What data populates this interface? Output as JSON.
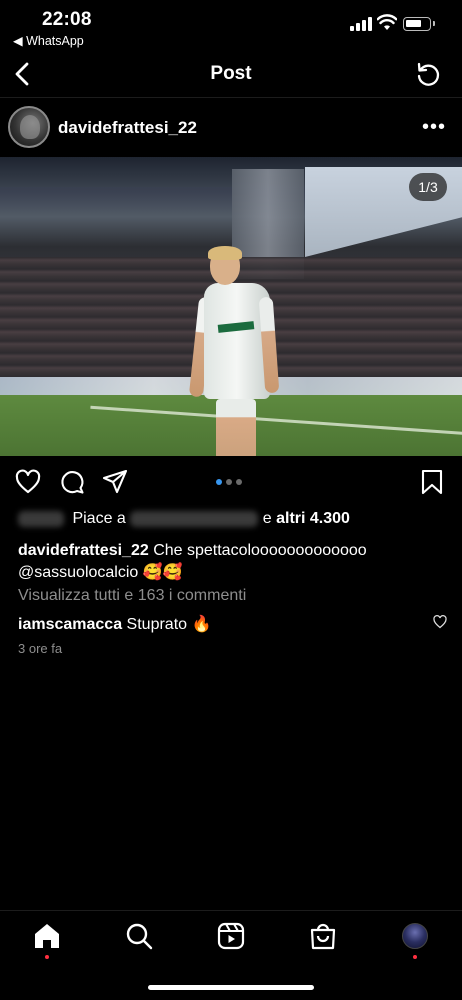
{
  "status_bar": {
    "time": "22:08",
    "back_app": "◀ WhatsApp"
  },
  "nav": {
    "title": "Post"
  },
  "post": {
    "username": "davidefrattesi_22",
    "photo_page": "1/3",
    "carousel": {
      "total": 3,
      "active": 1
    },
    "likes": {
      "prefix": "Piace a",
      "suffix": "e",
      "others": "altri 4.300"
    },
    "caption": {
      "username": "davidefrattesi_22",
      "text": "Che spettacolooooooooooooo",
      "mention": "@sassuolocalcio",
      "emoji": "🥰🥰"
    },
    "view_all_comments": "Visualizza tutti e 163 i commenti",
    "top_comment": {
      "username": "iamscamacca",
      "text": "Stuprato 🔥"
    },
    "time_ago": "3 ore fa"
  },
  "icons": {
    "nav": [
      "back-icon",
      "refresh-icon"
    ],
    "header": [
      "more-icon"
    ],
    "actions": [
      "heart-icon",
      "comment-icon",
      "share-icon",
      "bookmark-icon"
    ],
    "tabbar": [
      "home-icon",
      "search-icon",
      "reels-icon",
      "shop-icon",
      "profile-avatar"
    ]
  },
  "colors": {
    "background": "#000000",
    "muted_text": "#8e8e8e",
    "active_dot": "#3897f0",
    "notification_dot": "#ff3040"
  }
}
